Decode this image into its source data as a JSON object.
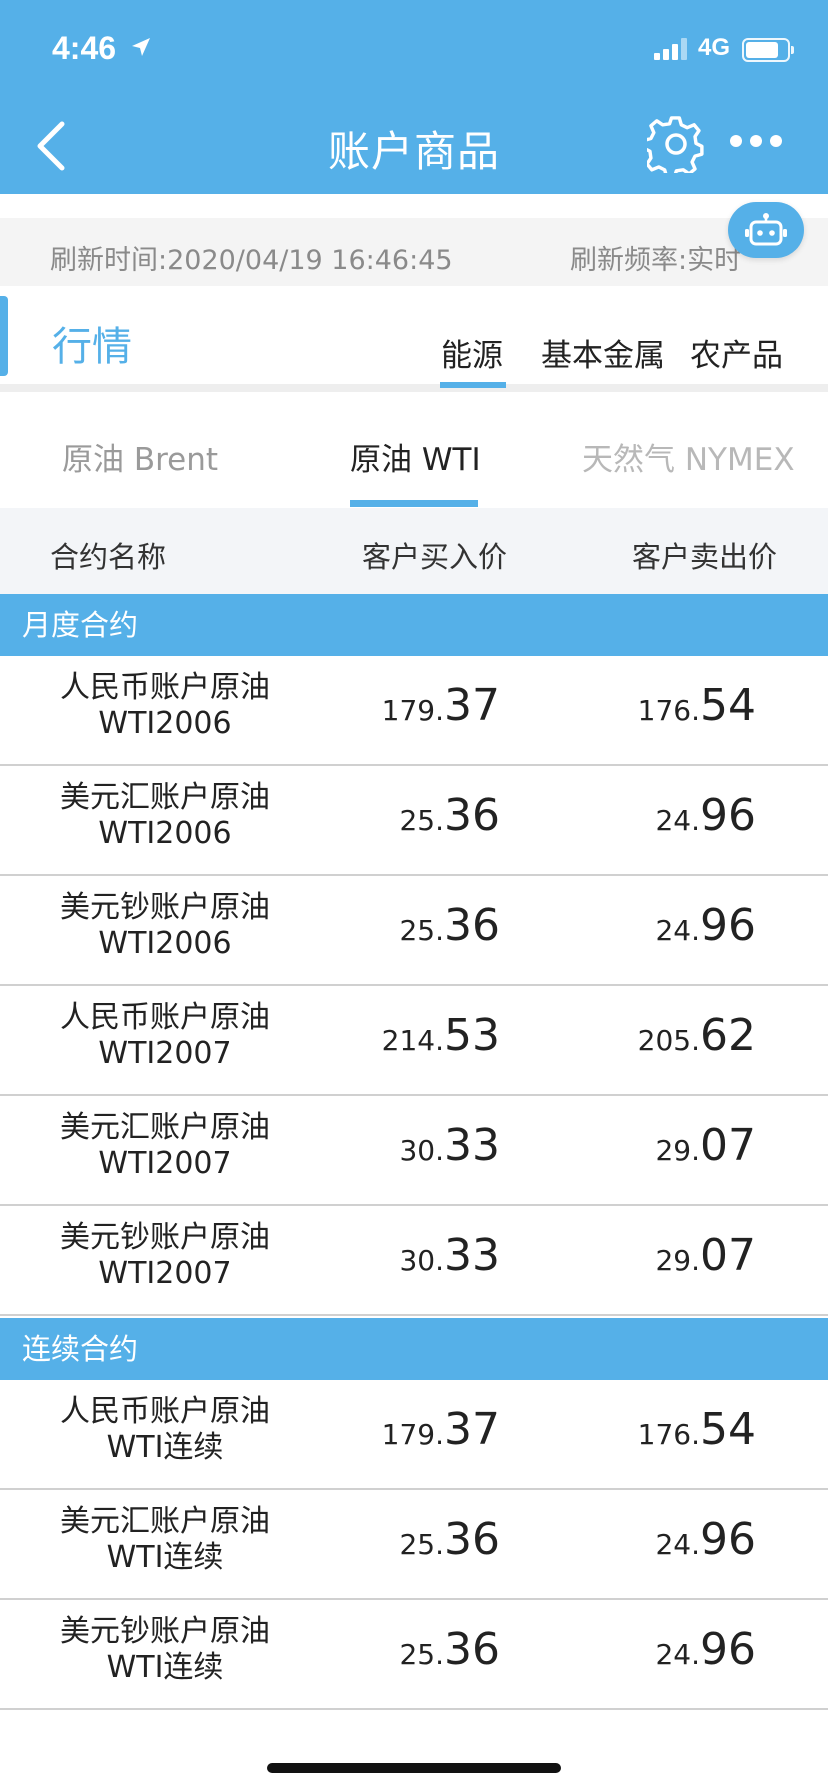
{
  "status_bar": {
    "time": "4:46",
    "network": "4G"
  },
  "header": {
    "title": "账户商品"
  },
  "refresh": {
    "time_label": "刷新时间:2020/04/19 16:46:45",
    "frequency_label": "刷新频率:实时"
  },
  "market": {
    "title": "行情",
    "categories": [
      "能源",
      "基本金属",
      "农产品"
    ],
    "selected_category": "能源"
  },
  "sub_tabs": {
    "items": [
      "原油 Brent",
      "原油 WTI",
      "天然气 NYMEX"
    ],
    "selected": "原油 WTI"
  },
  "columns": {
    "name": "合约名称",
    "buy": "客户买入价",
    "sell": "客户卖出价"
  },
  "sections": [
    {
      "title": "月度合约",
      "rows": [
        {
          "name_line1": "人民币账户原油",
          "name_line2": "WTI2006",
          "buy_int": "179.",
          "buy_dec": "37",
          "sell_int": "176.",
          "sell_dec": "54"
        },
        {
          "name_line1": "美元汇账户原油",
          "name_line2": "WTI2006",
          "buy_int": "25.",
          "buy_dec": "36",
          "sell_int": "24.",
          "sell_dec": "96"
        },
        {
          "name_line1": "美元钞账户原油",
          "name_line2": "WTI2006",
          "buy_int": "25.",
          "buy_dec": "36",
          "sell_int": "24.",
          "sell_dec": "96"
        },
        {
          "name_line1": "人民币账户原油",
          "name_line2": "WTI2007",
          "buy_int": "214.",
          "buy_dec": "53",
          "sell_int": "205.",
          "sell_dec": "62"
        },
        {
          "name_line1": "美元汇账户原油",
          "name_line2": "WTI2007",
          "buy_int": "30.",
          "buy_dec": "33",
          "sell_int": "29.",
          "sell_dec": "07"
        },
        {
          "name_line1": "美元钞账户原油",
          "name_line2": "WTI2007",
          "buy_int": "30.",
          "buy_dec": "33",
          "sell_int": "29.",
          "sell_dec": "07"
        }
      ]
    },
    {
      "title": "连续合约",
      "rows": [
        {
          "name_line1": "人民币账户原油",
          "name_line2": "WTI连续",
          "buy_int": "179.",
          "buy_dec": "37",
          "sell_int": "176.",
          "sell_dec": "54"
        },
        {
          "name_line1": "美元汇账户原油",
          "name_line2": "WTI连续",
          "buy_int": "25.",
          "buy_dec": "36",
          "sell_int": "24.",
          "sell_dec": "96"
        },
        {
          "name_line1": "美元钞账户原油",
          "name_line2": "WTI连续",
          "buy_int": "25.",
          "buy_dec": "36",
          "sell_int": "24.",
          "sell_dec": "96"
        }
      ]
    }
  ],
  "colors": {
    "accent": "#55b0e8",
    "text": "#222222",
    "muted": "#8a8a8a"
  },
  "icons": [
    "location-arrow-icon",
    "signal-icon",
    "battery-icon",
    "back-chevron-icon",
    "gear-icon",
    "more-icon",
    "robot-icon"
  ]
}
